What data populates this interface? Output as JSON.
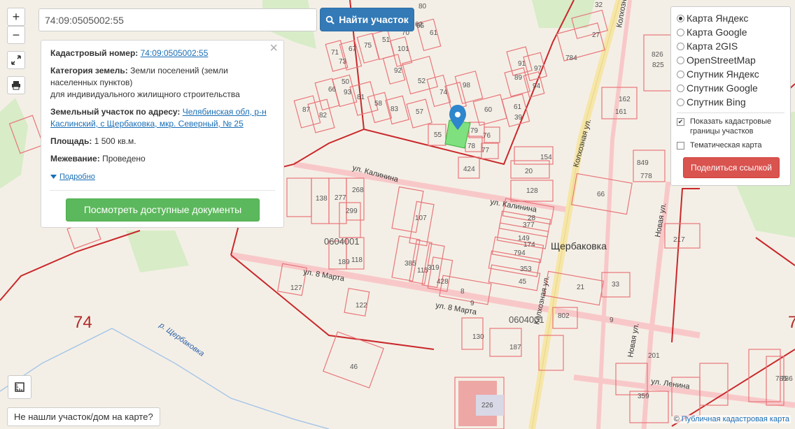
{
  "search": {
    "value": "74:09:0505002:55",
    "button_label": "Найти участок"
  },
  "zoom": {
    "in": "+",
    "out": "−"
  },
  "icons": {
    "fullscreen": "fullscreen-icon",
    "print": "print-icon",
    "ruler": "ruler-icon",
    "search": "search-icon",
    "pin": "map-pin-icon",
    "caret": "caret-down-icon",
    "close": "close-icon"
  },
  "info": {
    "cad_num_label": "Кадастровый номер:",
    "cad_num_value": "74:09:0505002:55",
    "category_label": "Категория земель:",
    "category_value": "Земли поселений (земли населенных пунктов)",
    "category_value2": "для индивидуального жилищного строительства",
    "address_label": "Земельный участок по адресу:",
    "address_value": "Челябинская обл, р-н Каслинский, с Щербаковка, мкр. Северный, № 25",
    "area_label": "Площадь:",
    "area_value": "1 500 кв.м.",
    "survey_label": "Межевание:",
    "survey_value": "Проведено",
    "details_label": "Подробно",
    "docs_button": "Посмотреть доступные документы",
    "close": "×"
  },
  "layers": {
    "options": [
      "Карта Яндекс",
      "Карта Google",
      "Карта 2GIS",
      "OpenStreetMap",
      "Спутник Яндекс",
      "Спутник Google",
      "Спутник Bing"
    ],
    "selected": "Карта Яндекс",
    "show_borders_label": "Показать кадастровые границы участков",
    "show_borders_checked": true,
    "thematic_label": "Тематическая карта",
    "thematic_checked": false,
    "share_button": "Поделиться ссылкой"
  },
  "bottom": {
    "not_found": "Не нашли участок/дом на карте?",
    "attribution_prefix": "©",
    "attribution_link": "Публичная кадастровая карта"
  },
  "map": {
    "colors": {
      "background": "#f4efe6",
      "parcel": "#e8767a",
      "block": "#c9282b",
      "road": "#f8c8c9",
      "main_road": "#f6e6a8",
      "green": "#d7ecc7",
      "highlight": "#7ee07e",
      "marker": "#2e86cc"
    },
    "labels": {
      "town": "Щербаковка",
      "street_kalinina": "ул. Калинина",
      "street_kalinina2": "ул. Калинина",
      "street_8marta": "ул. 8 Марта",
      "street_8marta2": "ул. 8 Марта",
      "street_kolkhoz": "Колхозная ул.",
      "street_kolkhoz2": "Колхозная ул.",
      "street_kolkhoz3": "Колхозная ул.",
      "street_novaya": "Новая ул.",
      "street_novaya2": "Новая ул.",
      "street_lenina": "ул. Ленина",
      "river": "р. Щербаковка",
      "region": "74",
      "block1": "0604001",
      "block2": "0604001",
      "edge_num": "7"
    },
    "parcel_numbers": [
      "71",
      "73",
      "67",
      "75",
      "51",
      "101",
      "80",
      "61",
      "62",
      "95",
      "70",
      "66",
      "93",
      "50",
      "92",
      "52",
      "74",
      "98",
      "91",
      "97",
      "89",
      "94",
      "87",
      "82",
      "81",
      "58",
      "83",
      "57",
      "55",
      "76",
      "79",
      "78",
      "77",
      "60",
      "61",
      "39",
      "424",
      "20",
      "154",
      "128",
      "138",
      "277",
      "268",
      "299",
      "107",
      "385",
      "115",
      "319",
      "428",
      "189",
      "118",
      "127",
      "122",
      "377",
      "149",
      "794",
      "353",
      "45",
      "8",
      "9",
      "21",
      "33",
      "802",
      "130",
      "187",
      "46",
      "226",
      "359",
      "201",
      "785",
      "786",
      "32",
      "27",
      "784",
      "826",
      "825",
      "162",
      "161",
      "849",
      "778",
      "217",
      "66",
      "174",
      "28",
      "9"
    ]
  }
}
